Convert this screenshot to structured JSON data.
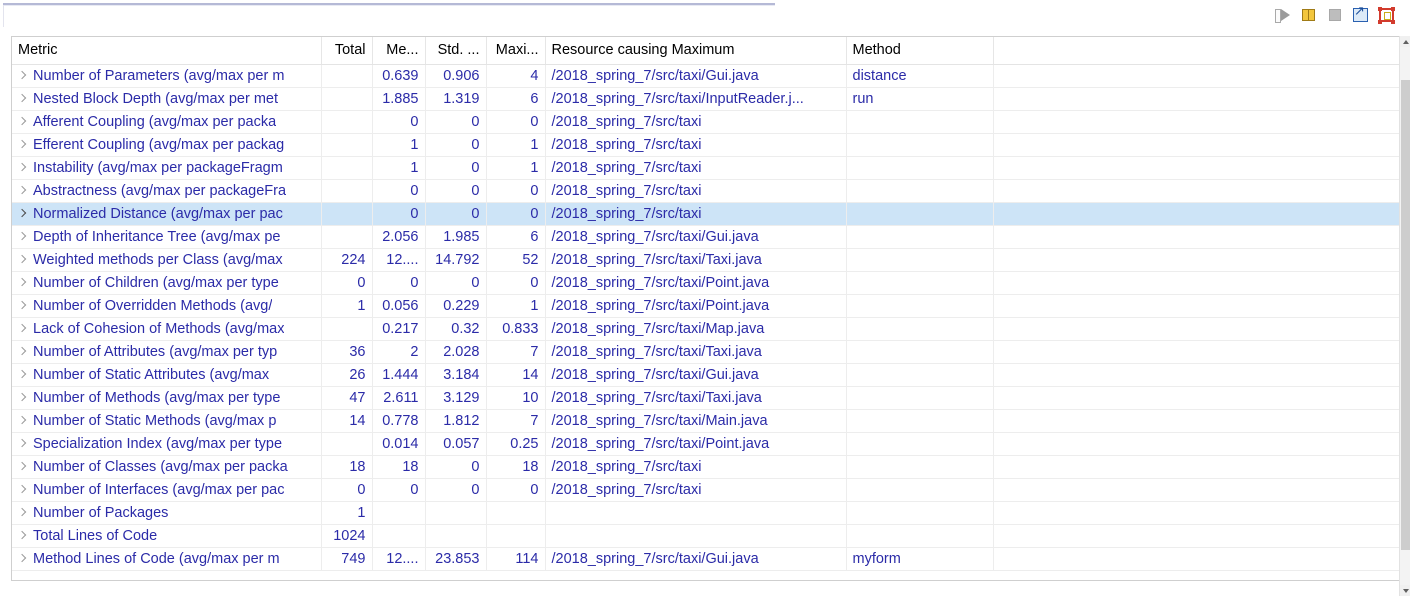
{
  "toolbar": {
    "buttons": [
      {
        "name": "resume-icon",
        "title": "Resume"
      },
      {
        "name": "pause-icon",
        "title": "Pause"
      },
      {
        "name": "stop-icon",
        "title": "Stop"
      },
      {
        "name": "export-icon",
        "title": "Export"
      },
      {
        "name": "fit-graph-icon",
        "title": "Show Graph"
      }
    ]
  },
  "table": {
    "columns": [
      {
        "key": "metric",
        "label": "Metric",
        "align": "left"
      },
      {
        "key": "total",
        "label": "Total",
        "align": "right"
      },
      {
        "key": "mean",
        "label": "Me...",
        "align": "right"
      },
      {
        "key": "std",
        "label": "Std. ...",
        "align": "right"
      },
      {
        "key": "max",
        "label": "Maxi...",
        "align": "right"
      },
      {
        "key": "res",
        "label": "Resource causing Maximum",
        "align": "left"
      },
      {
        "key": "method",
        "label": "Method",
        "align": "left"
      },
      {
        "key": "pad",
        "label": "",
        "align": "left"
      }
    ],
    "rows": [
      {
        "metric": "Number of Parameters (avg/max per m",
        "total": "",
        "mean": "0.639",
        "std": "0.906",
        "max": "4",
        "res": "/2018_spring_7/src/taxi/Gui.java",
        "method": "distance",
        "state": "normal"
      },
      {
        "metric": "Nested Block Depth (avg/max per met",
        "total": "",
        "mean": "1.885",
        "std": "1.319",
        "max": "6",
        "res": "/2018_spring_7/src/taxi/InputReader.j...",
        "method": "run",
        "state": "alert"
      },
      {
        "metric": "Afferent Coupling (avg/max per packa",
        "total": "",
        "mean": "0",
        "std": "0",
        "max": "0",
        "res": "/2018_spring_7/src/taxi",
        "method": "",
        "state": "normal"
      },
      {
        "metric": "Efferent Coupling (avg/max per packag",
        "total": "",
        "mean": "1",
        "std": "0",
        "max": "1",
        "res": "/2018_spring_7/src/taxi",
        "method": "",
        "state": "normal"
      },
      {
        "metric": "Instability (avg/max per packageFragm",
        "total": "",
        "mean": "1",
        "std": "0",
        "max": "1",
        "res": "/2018_spring_7/src/taxi",
        "method": "",
        "state": "normal"
      },
      {
        "metric": "Abstractness (avg/max per packageFra",
        "total": "",
        "mean": "0",
        "std": "0",
        "max": "0",
        "res": "/2018_spring_7/src/taxi",
        "method": "",
        "state": "normal"
      },
      {
        "metric": "Normalized Distance (avg/max per pac",
        "total": "",
        "mean": "0",
        "std": "0",
        "max": "0",
        "res": "/2018_spring_7/src/taxi",
        "method": "",
        "state": "selected"
      },
      {
        "metric": "Depth of Inheritance Tree (avg/max pe",
        "total": "",
        "mean": "2.056",
        "std": "1.985",
        "max": "6",
        "res": "/2018_spring_7/src/taxi/Gui.java",
        "method": "",
        "state": "normal"
      },
      {
        "metric": "Weighted methods per Class (avg/max",
        "total": "224",
        "mean": "12....",
        "std": "14.792",
        "max": "52",
        "res": "/2018_spring_7/src/taxi/Taxi.java",
        "method": "",
        "state": "normal"
      },
      {
        "metric": "Number of Children (avg/max per type",
        "total": "0",
        "mean": "0",
        "std": "0",
        "max": "0",
        "res": "/2018_spring_7/src/taxi/Point.java",
        "method": "",
        "state": "normal"
      },
      {
        "metric": "Number of Overridden Methods (avg/",
        "total": "1",
        "mean": "0.056",
        "std": "0.229",
        "max": "1",
        "res": "/2018_spring_7/src/taxi/Point.java",
        "method": "",
        "state": "normal"
      },
      {
        "metric": "Lack of Cohesion of Methods (avg/max",
        "total": "",
        "mean": "0.217",
        "std": "0.32",
        "max": "0.833",
        "res": "/2018_spring_7/src/taxi/Map.java",
        "method": "",
        "state": "normal"
      },
      {
        "metric": "Number of Attributes (avg/max per typ",
        "total": "36",
        "mean": "2",
        "std": "2.028",
        "max": "7",
        "res": "/2018_spring_7/src/taxi/Taxi.java",
        "method": "",
        "state": "normal"
      },
      {
        "metric": "Number of Static Attributes (avg/max ",
        "total": "26",
        "mean": "1.444",
        "std": "3.184",
        "max": "14",
        "res": "/2018_spring_7/src/taxi/Gui.java",
        "method": "",
        "state": "normal"
      },
      {
        "metric": "Number of Methods (avg/max per type",
        "total": "47",
        "mean": "2.611",
        "std": "3.129",
        "max": "10",
        "res": "/2018_spring_7/src/taxi/Taxi.java",
        "method": "",
        "state": "normal"
      },
      {
        "metric": "Number of Static Methods (avg/max p",
        "total": "14",
        "mean": "0.778",
        "std": "1.812",
        "max": "7",
        "res": "/2018_spring_7/src/taxi/Main.java",
        "method": "",
        "state": "normal"
      },
      {
        "metric": "Specialization Index (avg/max per type",
        "total": "",
        "mean": "0.014",
        "std": "0.057",
        "max": "0.25",
        "res": "/2018_spring_7/src/taxi/Point.java",
        "method": "",
        "state": "normal"
      },
      {
        "metric": "Number of Classes (avg/max per packa",
        "total": "18",
        "mean": "18",
        "std": "0",
        "max": "18",
        "res": "/2018_spring_7/src/taxi",
        "method": "",
        "state": "normal"
      },
      {
        "metric": "Number of Interfaces (avg/max per pac",
        "total": "0",
        "mean": "0",
        "std": "0",
        "max": "0",
        "res": "/2018_spring_7/src/taxi",
        "method": "",
        "state": "normal"
      },
      {
        "metric": "Number of Packages",
        "total": "1",
        "mean": "",
        "std": "",
        "max": "",
        "res": "",
        "method": "",
        "state": "normal"
      },
      {
        "metric": "Total Lines of Code",
        "total": "1024",
        "mean": "",
        "std": "",
        "max": "",
        "res": "",
        "method": "",
        "state": "normal"
      },
      {
        "metric": "Method Lines of Code (avg/max per m",
        "total": "749",
        "mean": "12....",
        "std": "23.853",
        "max": "114",
        "res": "/2018_spring_7/src/taxi/Gui.java",
        "method": "myform",
        "state": "normal"
      }
    ]
  },
  "colors": {
    "link_blue": "#2b2ba8",
    "alert_red": "#e02020",
    "selection_blue": "#cde4f7",
    "header_text": "#000000",
    "grid_line": "#ededed"
  },
  "scrollbar": {
    "up_arrow": "scroll-up-arrow",
    "down_arrow": "scroll-down-arrow",
    "thumb": "scroll-thumb"
  }
}
